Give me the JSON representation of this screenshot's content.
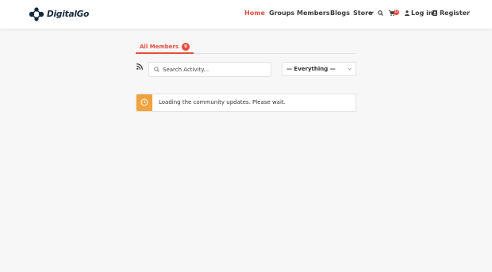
{
  "header": {
    "logo_text": "DigitalGo",
    "nav": {
      "home": "Home",
      "groups": "Groups",
      "members": "Members",
      "blogs": "Blogs",
      "store": "Store",
      "cart_count": "0",
      "login": "Log in",
      "register": "Register"
    }
  },
  "activity": {
    "tab_label": "All Members",
    "tab_count": "0",
    "search_placeholder": "Search Activity...",
    "filter_selected": "— Everything —",
    "notice": "Loading the community updates. Please wait."
  },
  "colors": {
    "accent": "#e84c3d",
    "notice": "#f0a33c",
    "logo": "#122a3a"
  }
}
